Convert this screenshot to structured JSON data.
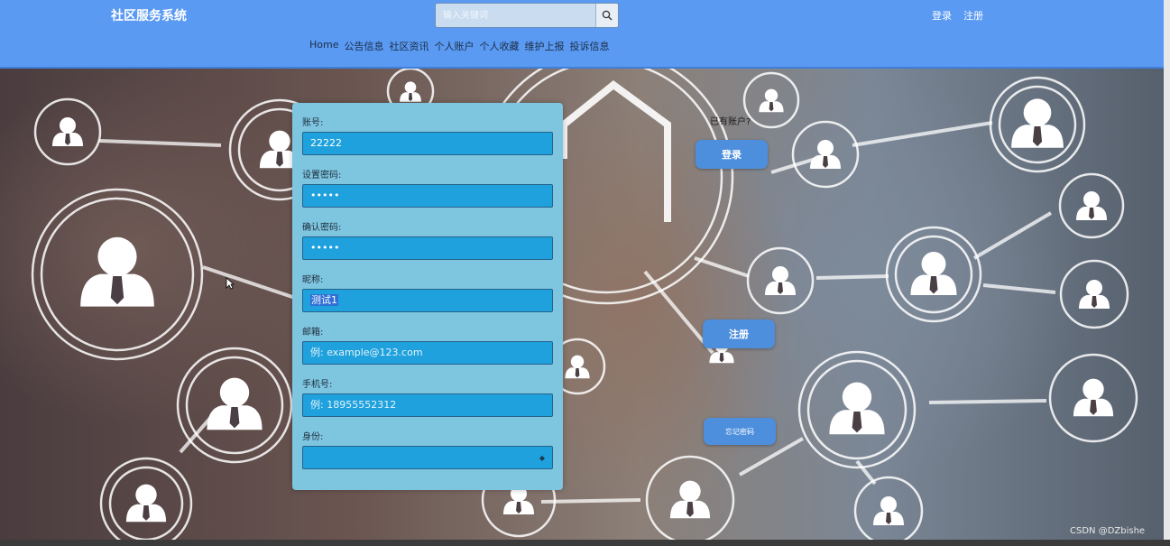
{
  "header": {
    "brand": "社区服务系统",
    "search_placeholder": "输入关键词",
    "login": "登录",
    "register": "注册",
    "nav": [
      "Home",
      "公告信息",
      "社区资讯",
      "个人账户",
      "个人收藏",
      "维护上报",
      "投诉信息"
    ]
  },
  "form": {
    "account": {
      "label": "账号:",
      "value": "22222"
    },
    "password": {
      "label": "设置密码:",
      "value": "•••••"
    },
    "confirm": {
      "label": "确认密码:",
      "value": "•••••"
    },
    "nickname": {
      "label": "昵称:",
      "value": "测试1"
    },
    "email": {
      "label": "邮箱:",
      "placeholder": "例: example@123.com"
    },
    "phone": {
      "label": "手机号:",
      "placeholder": "例: 18955552312"
    },
    "identity": {
      "label": "身份:",
      "value": ""
    }
  },
  "side": {
    "has_account": "已有账户?",
    "login_button": "登录",
    "register_button": "注册",
    "forgot_button": "忘记密码"
  },
  "watermark": "CSDN @DZbishe",
  "colors": {
    "header": "#5a9af2",
    "form_bg": "#7ec5e0",
    "input_bg": "#1ea1dc",
    "button": "#4d8fdd"
  }
}
